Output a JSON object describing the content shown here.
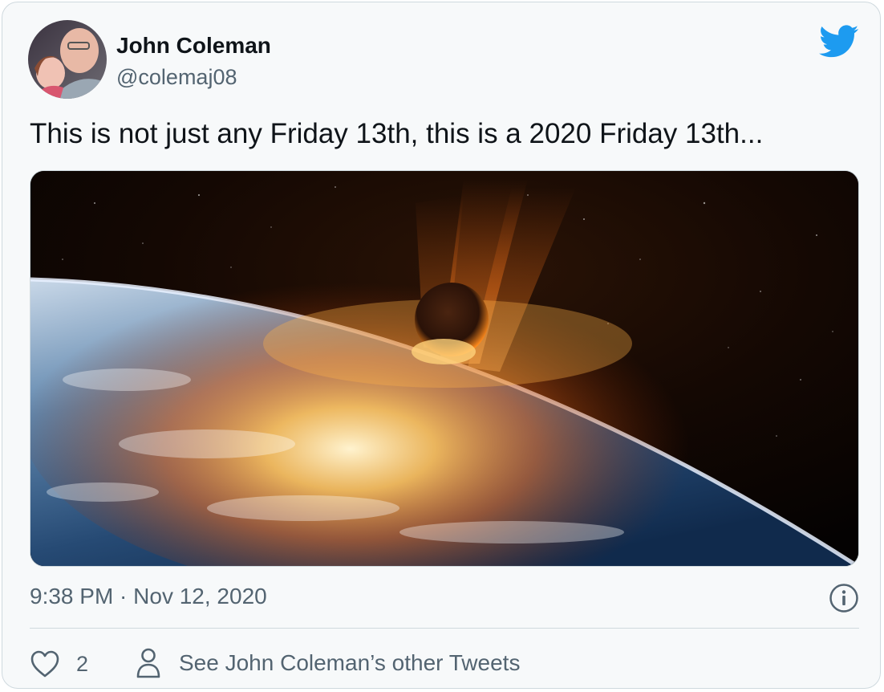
{
  "author": {
    "display_name": "John Coleman",
    "handle": "@colemaj08"
  },
  "tweet": {
    "text": "This is not just any Friday 13th, this is a 2020 Friday 13th...",
    "timestamp": "9:38 PM · Nov 12, 2020"
  },
  "actions": {
    "like_count": "2",
    "other_tweets_label": "See John Coleman’s other Tweets"
  },
  "icons": {
    "logo": "twitter-bird-icon",
    "info": "info-icon",
    "like": "heart-icon",
    "profile": "person-icon"
  },
  "colors": {
    "brand": "#1d9bf0",
    "text_primary": "#0f1419",
    "text_secondary": "#536471",
    "border": "#cfd9de",
    "card_background": "#f7f9fa"
  }
}
